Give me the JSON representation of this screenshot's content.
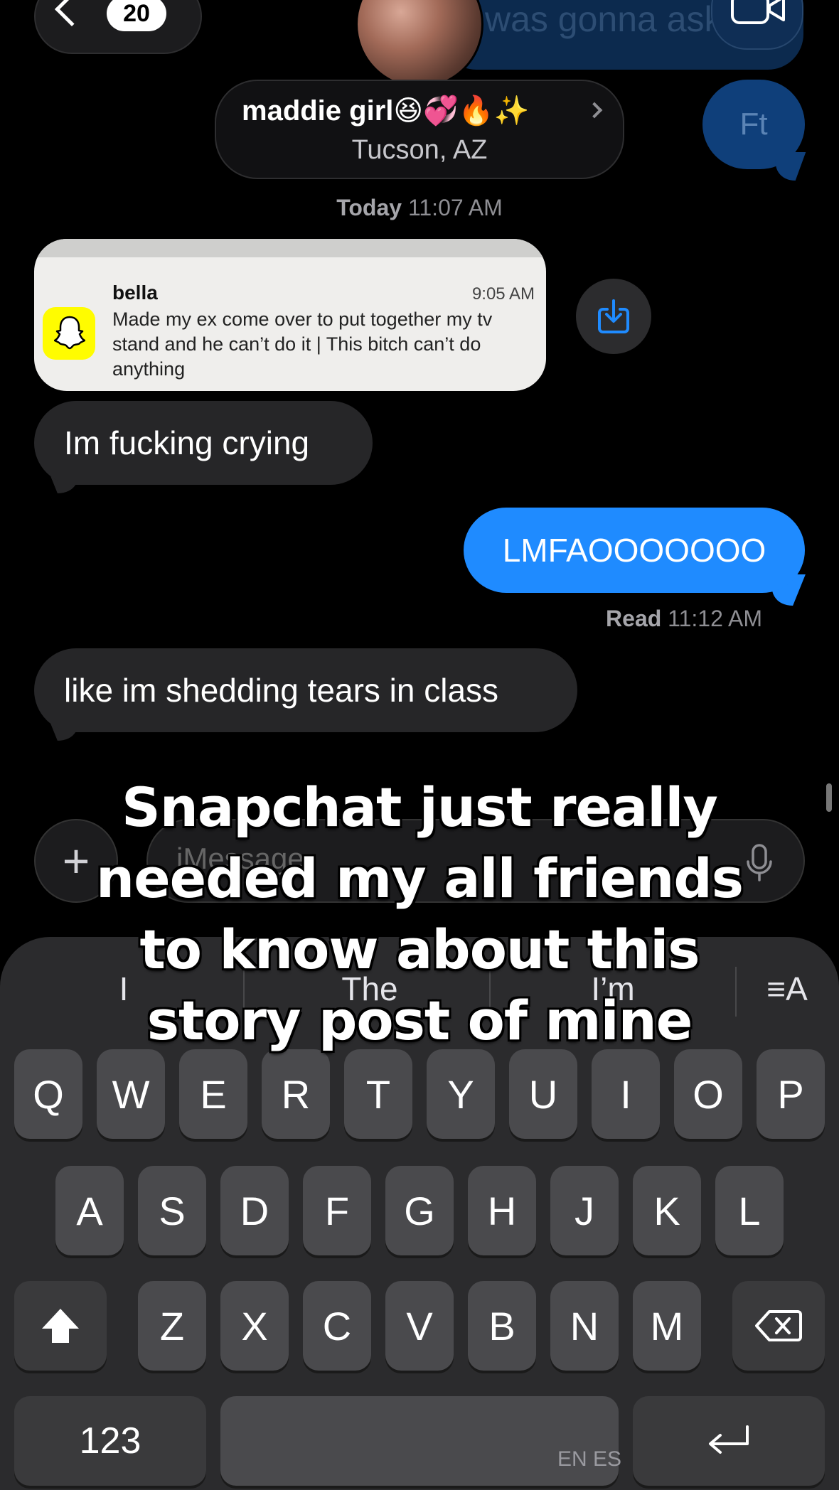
{
  "header": {
    "back_badge": "20",
    "ghost_message": "was gonna ask to",
    "contact_name": "maddie girl",
    "contact_emojis": "😆💞🔥✨",
    "contact_location": "Tucson, AZ"
  },
  "messages": {
    "ft_bubble": "Ft",
    "timestamp_day": "Today",
    "timestamp_time": "11:07 AM",
    "notification": {
      "sender": "bella",
      "time": "9:05 AM",
      "body": "Made my ex come over to put together my tv stand and he can’t do it | This bitch can’t do anything"
    },
    "msg1": "Im fucking crying",
    "msg2": "LMFAOOOOOOO",
    "read_label": "Read",
    "read_time": "11:12 AM",
    "msg3": "like im shedding tears in class"
  },
  "compose": {
    "plus": "+",
    "placeholder": "iMessage"
  },
  "caption": "Snapchat just really needed my all friends to know about this story post of mine",
  "keyboard": {
    "suggestions": [
      "I",
      "The",
      "I’m"
    ],
    "row1": [
      "Q",
      "W",
      "E",
      "R",
      "T",
      "Y",
      "U",
      "I",
      "O",
      "P"
    ],
    "row2": [
      "A",
      "S",
      "D",
      "F",
      "G",
      "H",
      "J",
      "K",
      "L"
    ],
    "row3": [
      "Z",
      "X",
      "C",
      "V",
      "B",
      "N",
      "M"
    ],
    "numbers_key": "123",
    "language": "EN ES",
    "format_key": "≡A"
  },
  "colors": {
    "outgoing": "#1f8bff",
    "incoming": "#262628",
    "snapchat": "#fffc00"
  }
}
